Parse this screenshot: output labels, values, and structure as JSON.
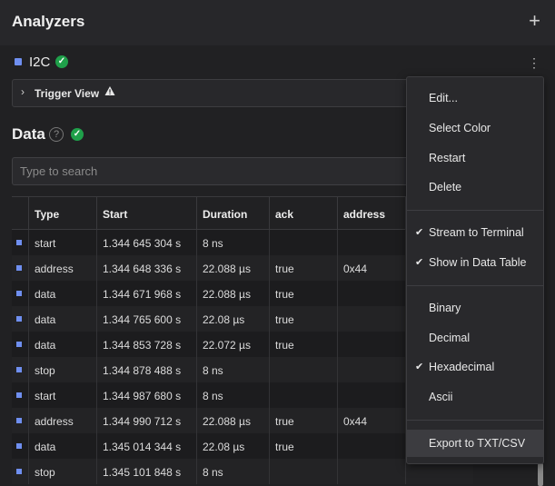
{
  "header": {
    "title": "Analyzers",
    "add_symbol": "+"
  },
  "analyzer": {
    "name": "I2C",
    "status_icon": "check-circle-icon",
    "accent_color": "#6f8ff0"
  },
  "trigger": {
    "label": "Trigger View",
    "warning_icon": "warning-triangle-icon"
  },
  "data_section": {
    "title": "Data",
    "help_symbol": "?"
  },
  "search": {
    "placeholder": "Type to search",
    "value": ""
  },
  "table": {
    "columns": [
      "",
      "Type",
      "Start",
      "Duration",
      "ack",
      "address",
      ""
    ],
    "rows": [
      {
        "type": "start",
        "start": "1.344 645 304 s",
        "duration": "8 ns",
        "ack": "",
        "address": ""
      },
      {
        "type": "address",
        "start": "1.344 648 336 s",
        "duration": "22.088 µs",
        "ack": "true",
        "address": "0x44"
      },
      {
        "type": "data",
        "start": "1.344 671 968 s",
        "duration": "22.088 µs",
        "ack": "true",
        "address": ""
      },
      {
        "type": "data",
        "start": "1.344 765 600 s",
        "duration": "22.08 µs",
        "ack": "true",
        "address": ""
      },
      {
        "type": "data",
        "start": "1.344 853 728 s",
        "duration": "22.072 µs",
        "ack": "true",
        "address": ""
      },
      {
        "type": "stop",
        "start": "1.344 878 488 s",
        "duration": "8 ns",
        "ack": "",
        "address": ""
      },
      {
        "type": "start",
        "start": "1.344 987 680 s",
        "duration": "8 ns",
        "ack": "",
        "address": ""
      },
      {
        "type": "address",
        "start": "1.344 990 712 s",
        "duration": "22.088 µs",
        "ack": "true",
        "address": "0x44"
      },
      {
        "type": "data",
        "start": "1.345 014 344 s",
        "duration": "22.08 µs",
        "ack": "true",
        "address": ""
      },
      {
        "type": "stop",
        "start": "1.345 101 848 s",
        "duration": "8 ns",
        "ack": "",
        "address": ""
      }
    ]
  },
  "context_menu": {
    "edit": "Edit...",
    "select_color": "Select Color",
    "restart": "Restart",
    "delete": "Delete",
    "stream_to_terminal": "Stream to Terminal",
    "show_in_data_table": "Show in Data Table",
    "binary": "Binary",
    "decimal": "Decimal",
    "hexadecimal": "Hexadecimal",
    "ascii": "Ascii",
    "export": "Export to TXT/CSV",
    "checked": [
      "stream_to_terminal",
      "show_in_data_table",
      "hexadecimal"
    ],
    "hovered": "export"
  }
}
